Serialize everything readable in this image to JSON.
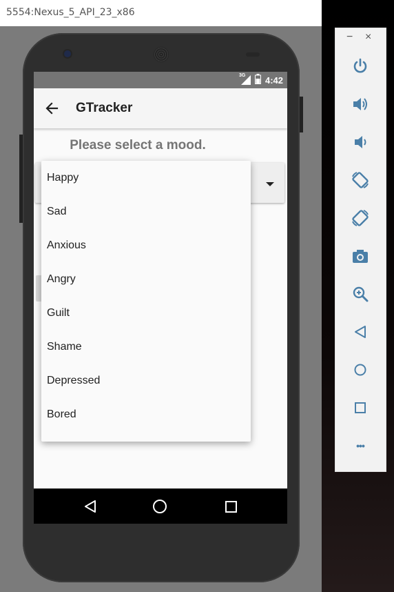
{
  "emulator": {
    "window_title": "5554:Nexus_5_API_23_x86",
    "toolbar": {
      "minimize_label": "−",
      "close_label": "×",
      "buttons": [
        {
          "name": "power-icon"
        },
        {
          "name": "volume-up-icon"
        },
        {
          "name": "volume-down-icon"
        },
        {
          "name": "rotate-left-icon"
        },
        {
          "name": "rotate-right-icon"
        },
        {
          "name": "camera-icon"
        },
        {
          "name": "zoom-icon"
        },
        {
          "name": "back-icon"
        },
        {
          "name": "home-icon"
        },
        {
          "name": "overview-icon"
        },
        {
          "name": "more-icon"
        }
      ],
      "more_label": "•••"
    }
  },
  "status_bar": {
    "network": "3G",
    "time": "4:42"
  },
  "app_bar": {
    "title": "GTracker"
  },
  "content": {
    "prompt": "Please select a mood."
  },
  "mood_dropdown": {
    "options": [
      "Happy",
      "Sad",
      "Anxious",
      "Angry",
      "Guilt",
      "Shame",
      "Depressed",
      "Bored"
    ]
  },
  "colors": {
    "status_bar": "#757575",
    "app_bar": "#f5f5f5",
    "emulator_bg": "#7b7b7b",
    "toolbar_icon": "#4a7fa8"
  }
}
